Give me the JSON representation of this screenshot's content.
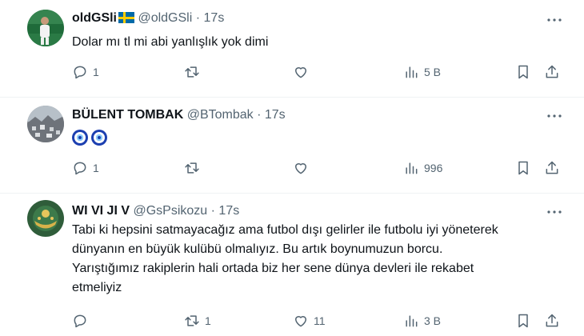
{
  "tweets": [
    {
      "display_name": "oldGSli",
      "handle": "@oldGSli",
      "separator": "·",
      "time": "17s",
      "text": "Dolar mı tl mi abi yanlışlık yok dimi",
      "replies": "1",
      "retweets": "",
      "likes": "",
      "views": "5 B"
    },
    {
      "display_name": "BÜLENT TOMBAK",
      "handle": "@BTombak",
      "separator": "·",
      "time": "17s",
      "text": "",
      "replies": "1",
      "retweets": "",
      "likes": "",
      "views": "996"
    },
    {
      "display_name": "WI VI JI V",
      "handle": "@GsPsikozu",
      "separator": "·",
      "time": "17s",
      "text_lines": [
        "Tabi ki hepsini satmayacağız ama futbol dışı gelirler ile futbolu iyi yöneterek",
        "dünyanın en büyük kulübü olmalıyız. Bu artık boynumuzun borcu.",
        "Yarıştığımız rakiplerin hali ortada biz her sene dünya devleri ile rekabet",
        "etmeliyiz"
      ],
      "replies": "",
      "retweets": "1",
      "likes": "11",
      "views": "3 B"
    }
  ],
  "icons": {
    "reply": "reply-icon",
    "retweet": "retweet-icon",
    "like": "heart-icon",
    "views": "views-icon",
    "bookmark": "bookmark-icon",
    "share": "share-icon",
    "more": "more-icon"
  },
  "colors": {
    "text": "#0f1419",
    "muted": "#536471",
    "divider": "#eff3f4"
  }
}
